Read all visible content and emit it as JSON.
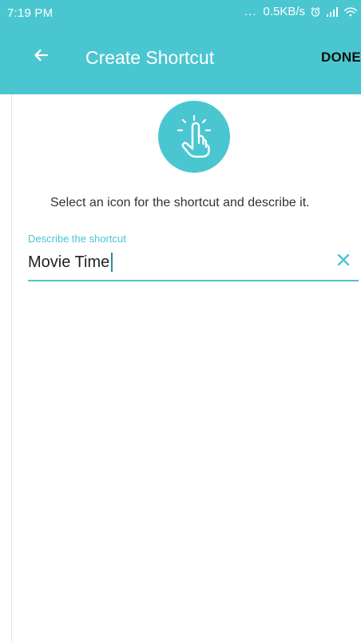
{
  "status_bar": {
    "time": "7:19 PM",
    "speed": "0.5KB/s",
    "icons": [
      "dots-icon",
      "alarm-icon",
      "signal-icon",
      "wifi-icon",
      "battery-icon"
    ]
  },
  "app_bar": {
    "title": "Create Shortcut",
    "done_label": "DONE",
    "back_icon": "back-arrow-icon",
    "accent_color": "#4ac6d1"
  },
  "hero": {
    "icon": "tap-hand-icon"
  },
  "content": {
    "helper_text": "Select an icon for the shortcut and describe it."
  },
  "form": {
    "label": "Describe the shortcut",
    "value": "Movie Time",
    "clear_icon": "clear-icon"
  }
}
